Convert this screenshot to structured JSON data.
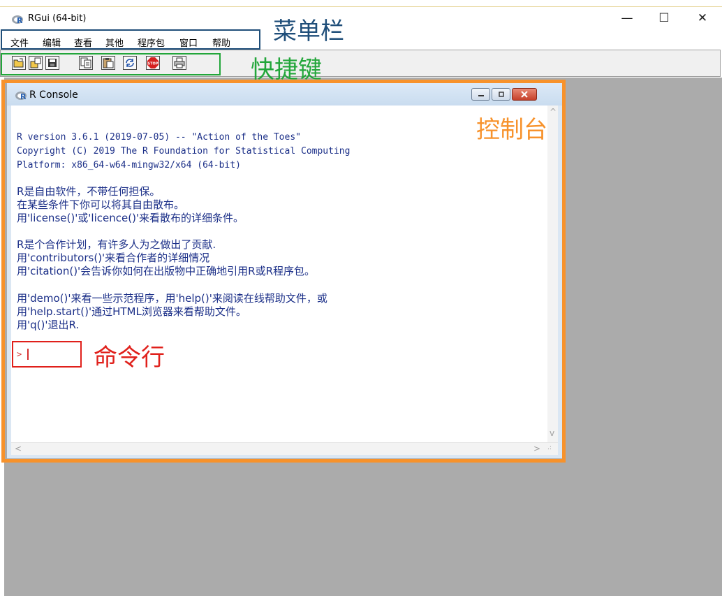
{
  "window": {
    "title": "RGui (64-bit)",
    "minimize": "—",
    "maximize": "☐",
    "close": "✕"
  },
  "menu": [
    {
      "label": "文件"
    },
    {
      "label": "编辑"
    },
    {
      "label": "查看"
    },
    {
      "label": "其他"
    },
    {
      "label": "程序包"
    },
    {
      "label": "窗口"
    },
    {
      "label": "帮助"
    }
  ],
  "toolbar": {
    "buttons": [
      {
        "icon": "open-folder-icon"
      },
      {
        "icon": "load-workspace-icon"
      },
      {
        "icon": "save-icon"
      },
      {
        "icon": "copy-icon"
      },
      {
        "icon": "paste-icon"
      },
      {
        "icon": "refresh-icon"
      },
      {
        "icon": "stop-icon",
        "label": "STOP"
      },
      {
        "icon": "print-icon"
      }
    ]
  },
  "console": {
    "title": "R Console",
    "lines": {
      "l1": "R version 3.6.1 (2019-07-05) -- \"Action of the Toes\"",
      "l2": "Copyright (C) 2019 The R Foundation for Statistical Computing",
      "l3": "Platform: x86_64-w64-mingw32/x64 (64-bit)",
      "l4": "R是自由软件，不带任何担保。",
      "l5": "在某些条件下你可以将其自由散布。",
      "l6": "用'license()'或'licence()'来看散布的详细条件。",
      "l7": "R是个合作计划，有许多人为之做出了贡献.",
      "l8": "用'contributors()'来看合作者的详细情况",
      "l9": "用'citation()'会告诉你如何在出版物中正确地引用R或R程序包。",
      "l10": "用'demo()'来看一些示范程序，用'help()'来阅读在线帮助文件，或",
      "l11": "用'help.start()'通过HTML浏览器来看帮助文件。",
      "l12": "用'q()'退出R."
    },
    "prompt": ">"
  },
  "annotations": {
    "menubar": "菜单栏",
    "toolbar": "快捷键",
    "console": "控制台",
    "command_line": "命令行"
  },
  "colors": {
    "console_text": "#1b2f88",
    "menubar_box": "#1f4e79",
    "toolbar_box": "#22a63a",
    "console_box": "#f7922b",
    "command_box": "#e0201b"
  }
}
